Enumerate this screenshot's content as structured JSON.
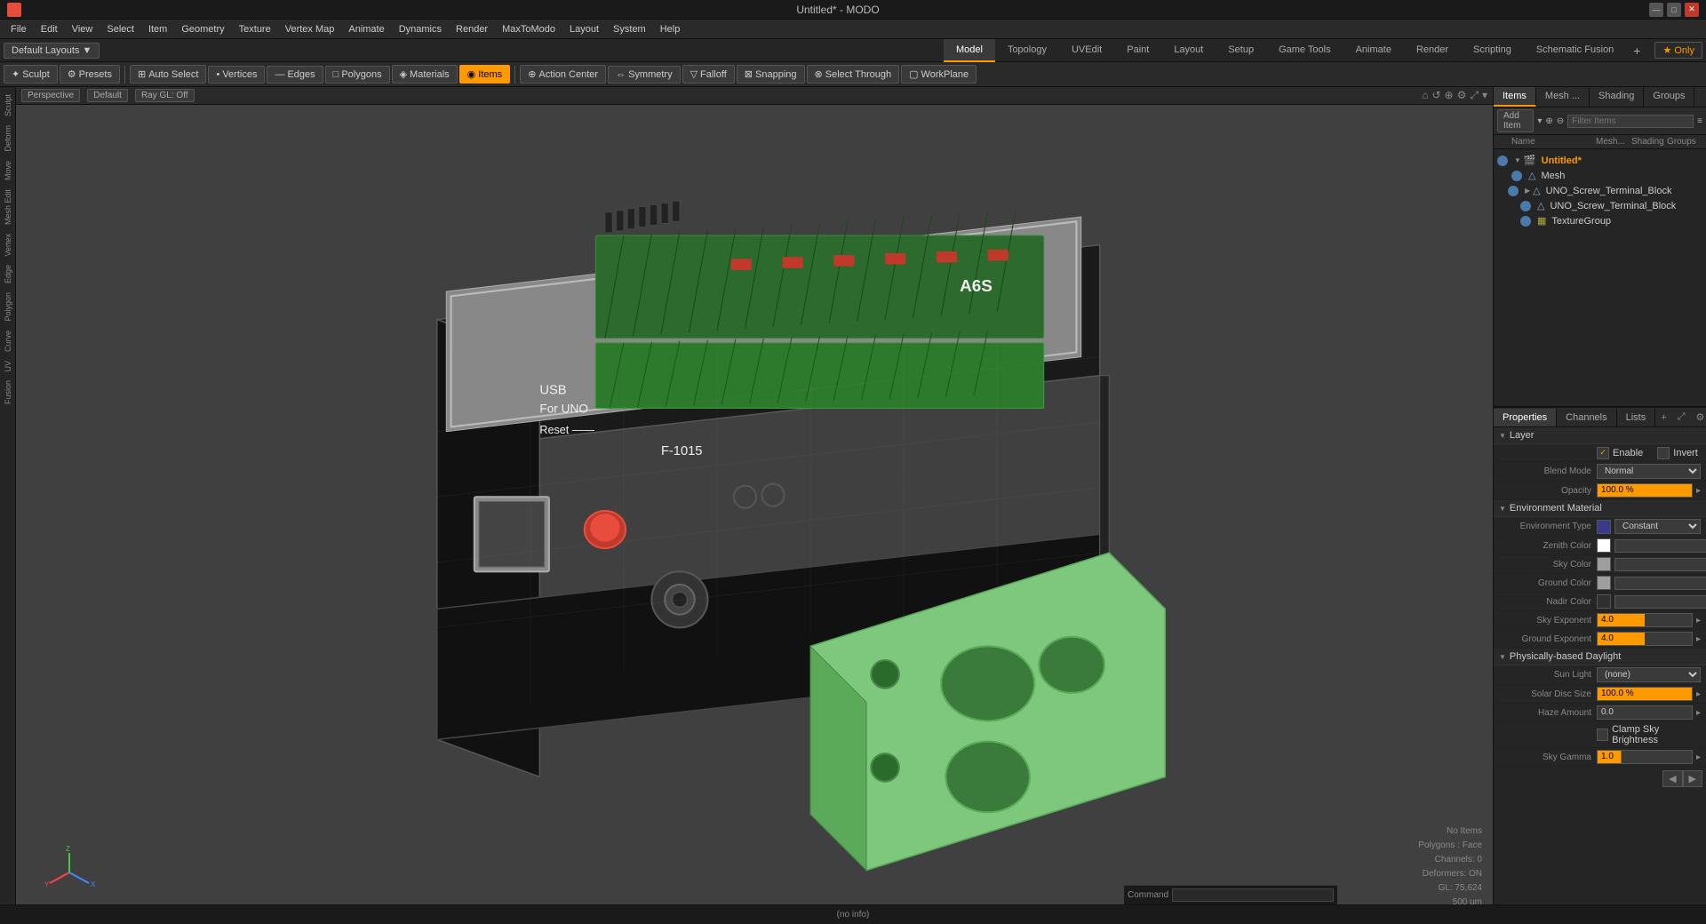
{
  "titlebar": {
    "title": "Untitled* - MODO",
    "min_label": "—",
    "max_label": "□",
    "close_label": "✕"
  },
  "menubar": {
    "items": [
      "File",
      "Edit",
      "View",
      "Select",
      "Item",
      "Geometry",
      "Texture",
      "Vertex Map",
      "Animate",
      "Dynamics",
      "Render",
      "MaxToModo",
      "Layout",
      "System",
      "Help"
    ]
  },
  "layoutbar": {
    "dropdown_label": "Default Layouts ▼",
    "tabs": [
      "Model",
      "Topology",
      "UVEdit",
      "Paint",
      "Layout",
      "Setup",
      "Game Tools",
      "Animate",
      "Render",
      "Scripting",
      "Schematic Fusion"
    ],
    "active_tab": "Model",
    "plus_label": "+",
    "only_label": "★ Only"
  },
  "toolbar": {
    "sculpt_label": "Sculpt",
    "presets_label": "Presets",
    "auto_select_label": "Auto Select",
    "vertices_label": "Vertices",
    "edges_label": "Edges",
    "polygons_label": "Polygons",
    "materials_label": "Materials",
    "items_label": "Items",
    "action_center_label": "Action Center",
    "symmetry_label": "Symmetry",
    "falloff_label": "Falloff",
    "snapping_label": "Snapping",
    "select_through_label": "Select Through",
    "workplane_label": "WorkPlane"
  },
  "viewport": {
    "perspective_label": "Perspective",
    "default_label": "Default",
    "raygl_label": "Ray GL: Off"
  },
  "left_palette": {
    "items": [
      "Sculpt",
      "Deform",
      "Move",
      "Mesh Edit",
      "Vertex",
      "Edge",
      "Polygon",
      "Curve",
      "UV",
      "Fusion"
    ]
  },
  "scene_tree": {
    "add_item_label": "Add Item",
    "filter_label": "Filter Items",
    "columns": [
      "Name",
      "Mesh ...",
      "Shading",
      "Groups"
    ],
    "items": [
      {
        "name": "Untitled*",
        "type": "scene",
        "depth": 0,
        "indent": 0
      },
      {
        "name": "Mesh",
        "type": "mesh",
        "depth": 1,
        "indent": 1
      },
      {
        "name": "UNO_Screw_Terminal_Block",
        "type": "mesh",
        "depth": 1,
        "indent": 2
      },
      {
        "name": "UNO_Screw_Terminal_Block",
        "type": "mesh",
        "depth": 2,
        "indent": 3
      },
      {
        "name": "TextureGroup",
        "type": "texture",
        "depth": 2,
        "indent": 3
      }
    ]
  },
  "properties": {
    "tabs": [
      "Properties",
      "Channels",
      "Lists"
    ],
    "active_tab": "Properties",
    "sections": {
      "layer": {
        "title": "Layer",
        "enable_label": "Enable",
        "enable_checked": true,
        "invert_label": "Invert",
        "blend_mode_label": "Blend Mode",
        "blend_mode_value": "Normal",
        "opacity_label": "Opacity",
        "opacity_value": "100.0 %"
      },
      "environment_material": {
        "title": "Environment Material",
        "env_type_label": "Environment Type",
        "env_type_value": "Constant",
        "zenith_color_label": "Zenith Color",
        "zenith_r": "1.0",
        "zenith_g": "1.0",
        "zenith_b": "1.0",
        "sky_color_label": "Sky Color",
        "sky_r": "0.62",
        "sky_g": "0.62",
        "sky_b": "0.62",
        "ground_color_label": "Ground Color",
        "ground_r": "0.62",
        "ground_g": "0.62",
        "ground_b": "0.62",
        "nadir_color_label": "Nadir Color",
        "nadir_r": "0.19",
        "nadir_g": "0.19",
        "nadir_b": "0.19",
        "sky_exponent_label": "Sky Exponent",
        "sky_exponent_value": "4.0",
        "ground_exponent_label": "Ground Exponent",
        "ground_exponent_value": "4.0"
      },
      "daylight": {
        "title": "Physically-based Daylight",
        "sun_light_label": "Sun Light",
        "sun_light_value": "(none)",
        "solar_disc_label": "Solar Disc Size",
        "solar_disc_value": "100.0 %",
        "haze_amount_label": "Haze Amount",
        "haze_value": "0.0",
        "clamp_label": "Clamp Sky Brightness",
        "sky_gamma_label": "Sky Gamma",
        "sky_gamma_value": "1.0",
        "haze_amount_num": "500 um"
      }
    }
  },
  "status": {
    "no_items_label": "No Items",
    "polygons_label": "Polygons : Face",
    "channels_label": "Channels: 0",
    "deformers_label": "Deformers: ON",
    "gl_label": "GL: 75,624",
    "size_label": "500 um",
    "bottom_info": "(no info)",
    "command_label": "Command"
  }
}
